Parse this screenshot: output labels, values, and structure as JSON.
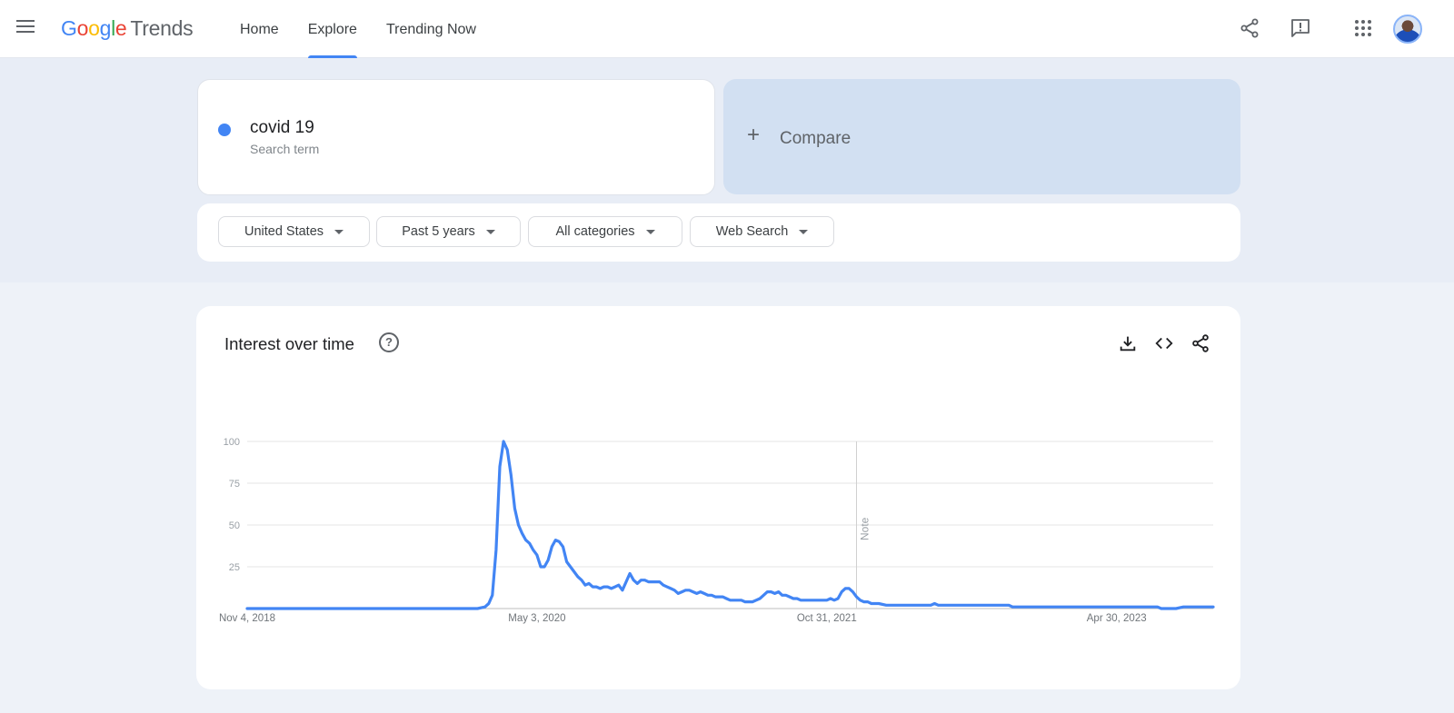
{
  "app": {
    "logo_letters": [
      "G",
      "o",
      "o",
      "g",
      "l",
      "e"
    ],
    "logo_product": "Trends"
  },
  "nav": {
    "items": [
      {
        "label": "Home",
        "active": false
      },
      {
        "label": "Explore",
        "active": true
      },
      {
        "label": "Trending Now",
        "active": false
      }
    ]
  },
  "top_icons": [
    "share-icon",
    "feedback-icon",
    "apps-grid-icon",
    "account-avatar"
  ],
  "search_term": {
    "name": "covid 19",
    "type_label": "Search term",
    "color": "#4285f4"
  },
  "compare": {
    "plus": "+",
    "label": "Compare"
  },
  "filters": [
    {
      "label": "United States"
    },
    {
      "label": "Past 5 years"
    },
    {
      "label": "All categories"
    },
    {
      "label": "Web Search"
    }
  ],
  "chart_card": {
    "title": "Interest over time",
    "help": "?",
    "actions": [
      "download-icon",
      "embed-code-icon",
      "share-icon"
    ]
  },
  "chart_data": {
    "type": "line",
    "title": "Interest over time",
    "xlabel": "",
    "ylabel": "",
    "ylim": [
      0,
      100
    ],
    "yticks": [
      25,
      50,
      75,
      100
    ],
    "grid": true,
    "x_tick_labels": [
      {
        "label": "Nov 4, 2018",
        "week": 0
      },
      {
        "label": "May 3, 2020",
        "week": 78
      },
      {
        "label": "Oct 31, 2021",
        "week": 156
      },
      {
        "label": "Apr 30, 2023",
        "week": 234
      }
    ],
    "annotations": [
      {
        "label": "Note",
        "week": 164
      }
    ],
    "x_range_weeks": [
      0,
      260
    ],
    "series": [
      {
        "name": "covid 19",
        "color": "#4285f4",
        "points": [
          [
            0,
            0
          ],
          [
            10,
            0
          ],
          [
            20,
            0
          ],
          [
            30,
            0
          ],
          [
            40,
            0
          ],
          [
            50,
            0
          ],
          [
            55,
            0
          ],
          [
            60,
            0
          ],
          [
            62,
            0
          ],
          [
            64,
            1
          ],
          [
            65,
            3
          ],
          [
            66,
            8
          ],
          [
            67,
            35
          ],
          [
            68,
            85
          ],
          [
            69,
            100
          ],
          [
            70,
            95
          ],
          [
            71,
            80
          ],
          [
            72,
            60
          ],
          [
            73,
            50
          ],
          [
            74,
            45
          ],
          [
            75,
            41
          ],
          [
            76,
            39
          ],
          [
            77,
            35
          ],
          [
            78,
            32
          ],
          [
            79,
            25
          ],
          [
            80,
            25
          ],
          [
            81,
            29
          ],
          [
            82,
            37
          ],
          [
            83,
            41
          ],
          [
            84,
            40
          ],
          [
            85,
            37
          ],
          [
            86,
            28
          ],
          [
            87,
            25
          ],
          [
            88,
            22
          ],
          [
            89,
            19
          ],
          [
            90,
            17
          ],
          [
            91,
            14
          ],
          [
            92,
            15
          ],
          [
            93,
            13
          ],
          [
            94,
            13
          ],
          [
            95,
            12
          ],
          [
            96,
            13
          ],
          [
            97,
            13
          ],
          [
            98,
            12
          ],
          [
            99,
            13
          ],
          [
            100,
            14
          ],
          [
            101,
            11
          ],
          [
            102,
            16
          ],
          [
            103,
            21
          ],
          [
            104,
            17
          ],
          [
            105,
            15
          ],
          [
            106,
            17
          ],
          [
            107,
            17
          ],
          [
            108,
            16
          ],
          [
            109,
            16
          ],
          [
            110,
            16
          ],
          [
            111,
            16
          ],
          [
            112,
            14
          ],
          [
            113,
            13
          ],
          [
            114,
            12
          ],
          [
            115,
            11
          ],
          [
            116,
            9
          ],
          [
            117,
            10
          ],
          [
            118,
            11
          ],
          [
            119,
            11
          ],
          [
            120,
            10
          ],
          [
            121,
            9
          ],
          [
            122,
            10
          ],
          [
            123,
            9
          ],
          [
            124,
            8
          ],
          [
            125,
            8
          ],
          [
            126,
            7
          ],
          [
            127,
            7
          ],
          [
            128,
            7
          ],
          [
            129,
            6
          ],
          [
            130,
            5
          ],
          [
            131,
            5
          ],
          [
            132,
            5
          ],
          [
            133,
            5
          ],
          [
            134,
            4
          ],
          [
            135,
            4
          ],
          [
            136,
            4
          ],
          [
            137,
            5
          ],
          [
            138,
            6
          ],
          [
            139,
            8
          ],
          [
            140,
            10
          ],
          [
            141,
            10
          ],
          [
            142,
            9
          ],
          [
            143,
            10
          ],
          [
            144,
            8
          ],
          [
            145,
            8
          ],
          [
            146,
            7
          ],
          [
            147,
            6
          ],
          [
            148,
            6
          ],
          [
            149,
            5
          ],
          [
            150,
            5
          ],
          [
            151,
            5
          ],
          [
            152,
            5
          ],
          [
            153,
            5
          ],
          [
            154,
            5
          ],
          [
            155,
            5
          ],
          [
            156,
            5
          ],
          [
            157,
            6
          ],
          [
            158,
            5
          ],
          [
            159,
            6
          ],
          [
            160,
            10
          ],
          [
            161,
            12
          ],
          [
            162,
            12
          ],
          [
            163,
            10
          ],
          [
            164,
            7
          ],
          [
            165,
            5
          ],
          [
            166,
            4
          ],
          [
            167,
            4
          ],
          [
            168,
            3
          ],
          [
            169,
            3
          ],
          [
            170,
            3
          ],
          [
            172,
            2
          ],
          [
            175,
            2
          ],
          [
            180,
            2
          ],
          [
            184,
            2
          ],
          [
            185,
            3
          ],
          [
            186,
            2
          ],
          [
            190,
            2
          ],
          [
            200,
            2
          ],
          [
            205,
            2
          ],
          [
            206,
            1
          ],
          [
            210,
            1
          ],
          [
            220,
            1
          ],
          [
            230,
            1
          ],
          [
            240,
            1
          ],
          [
            245,
            1
          ],
          [
            246,
            0
          ],
          [
            250,
            0
          ],
          [
            252,
            1
          ],
          [
            260,
            1
          ]
        ]
      }
    ]
  }
}
